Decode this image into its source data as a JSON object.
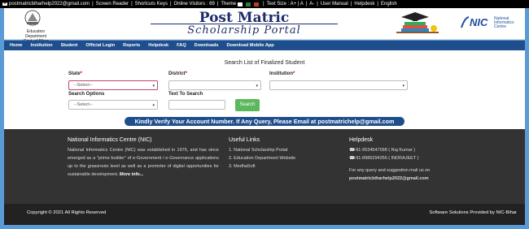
{
  "topbar": {
    "email": "postmatricbiharhelp2022@gmail.com",
    "screen_reader": "Screen Reader",
    "shortcuts": "Shortcuts Keys",
    "visitors": "Online Visitors : 89",
    "theme": "Theme",
    "text_size": "Text Size : A+ | A",
    "a_minus": "A-",
    "user_manual": "User Manual",
    "helpdesk": "Helpdesk",
    "english": "English",
    "theme_colors": [
      "#ffffff",
      "#2e7d32",
      "#c0392b"
    ]
  },
  "header": {
    "title": "Post Matric",
    "subtitle": "Scholarship Portal",
    "dept_line1": "Education Department",
    "dept_line2": "Govt. of Bihar",
    "nic_label": "NIC",
    "nic_sub": "National Informatics Centre"
  },
  "nav": [
    "Home",
    "Institution",
    "Student",
    "Official Login",
    "Reports",
    "Helpdesk",
    "FAQ",
    "Downloads",
    "Download Mobile App"
  ],
  "search": {
    "title": "Search List of Finalized Student",
    "state_label": "State",
    "state_value": "--Select--",
    "district_label": "District",
    "institution_label": "Institution",
    "options_label": "Search Options",
    "options_value": "--Select--",
    "text_label": "Text To Search",
    "button": "Search",
    "required_mark": "*"
  },
  "banner": "Kindly Verify Your Account Number. If Any Query, Please Email at postmatrichelp@gmail.com",
  "footer": {
    "nic_title": "National Informatics Centre (NIC)",
    "nic_text": "National Informatics Centre (NIC) was established in 1976, and has since emerged as a \"prime builder\" of e-Government / e-Governance applications up to the grassroots level as well as a promoter of digital opportunities for sustainable development.",
    "more_info": "More info...",
    "links_title": "Useful Links",
    "links": [
      "1. National Scholarship Portal",
      "2. Education Department Website",
      "3. MedhaSoft"
    ],
    "help_title": "Helpdesk",
    "phones": [
      "+91-9534547098 ( Raj Kumar )",
      "+91-8986294256 ( INDRAJEET )"
    ],
    "query_text": "For any query and suggestion mail us on",
    "query_email": "postmatricbiharhelp2022@gmail.com"
  },
  "bottom": {
    "copyright": "Copyright © 2021 All Rights Reserved",
    "credit": "Software Solutions Provided by NIC-Bihar"
  }
}
